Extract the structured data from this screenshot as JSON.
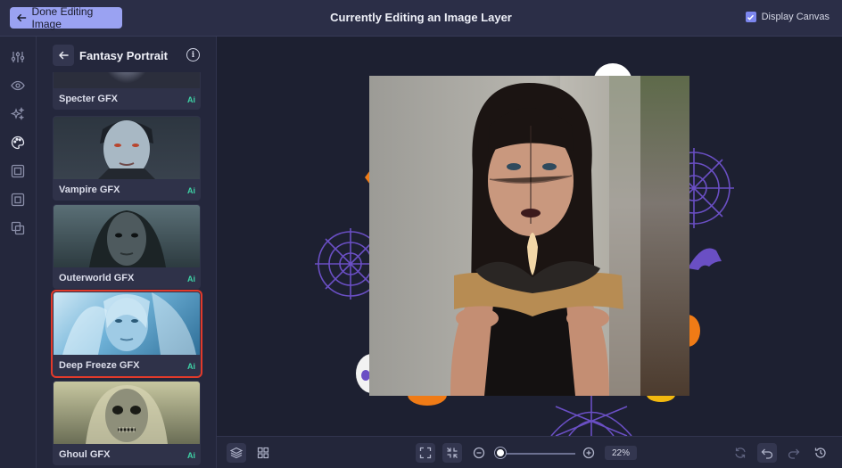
{
  "topbar": {
    "done_label": "Done Editing Image",
    "title": "Currently Editing an Image Layer",
    "display_canvas_label": "Display Canvas",
    "display_canvas_checked": true
  },
  "rail": {
    "icons": [
      "adjust-sliders-icon",
      "eye-icon",
      "sparkles-icon",
      "palette-icon",
      "frame-icon",
      "crop-icon",
      "layers-overlap-icon"
    ]
  },
  "panel": {
    "title": "Fantasy Portrait",
    "items": [
      {
        "label": "Specter GFX",
        "badge": "Ai"
      },
      {
        "label": "Vampire GFX",
        "badge": "Ai"
      },
      {
        "label": "Outerworld GFX",
        "badge": "Ai"
      },
      {
        "label": "Deep Freeze GFX",
        "badge": "Ai",
        "selected": true
      },
      {
        "label": "Ghoul GFX",
        "badge": "Ai"
      }
    ]
  },
  "bottombar": {
    "zoom": "22%",
    "zoom_slider_fraction": 0.02
  },
  "colors": {
    "accent": "#9aa2f2",
    "selection": "#e23a2b",
    "ai_badge": "#3ed3a6"
  }
}
